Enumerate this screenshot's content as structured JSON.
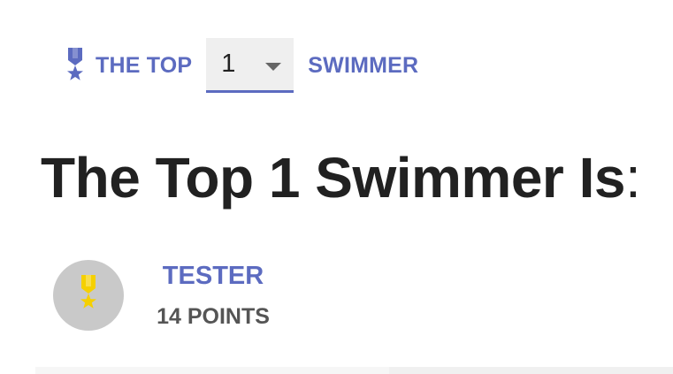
{
  "header": {
    "prefix_label": "THE TOP",
    "selected_count": "1",
    "suffix_label": "SWIMMER",
    "icon": "medal-icon",
    "accent_color": "#5c6bc0"
  },
  "title": {
    "text": "The Top 1 Swimmer Is",
    "colon": ":"
  },
  "winner": {
    "avatar_icon": "medal-icon",
    "avatar_color": "#c9c9c9",
    "medal_color": "#f5d000",
    "name": "TESTER",
    "points": "14 POINTS"
  }
}
